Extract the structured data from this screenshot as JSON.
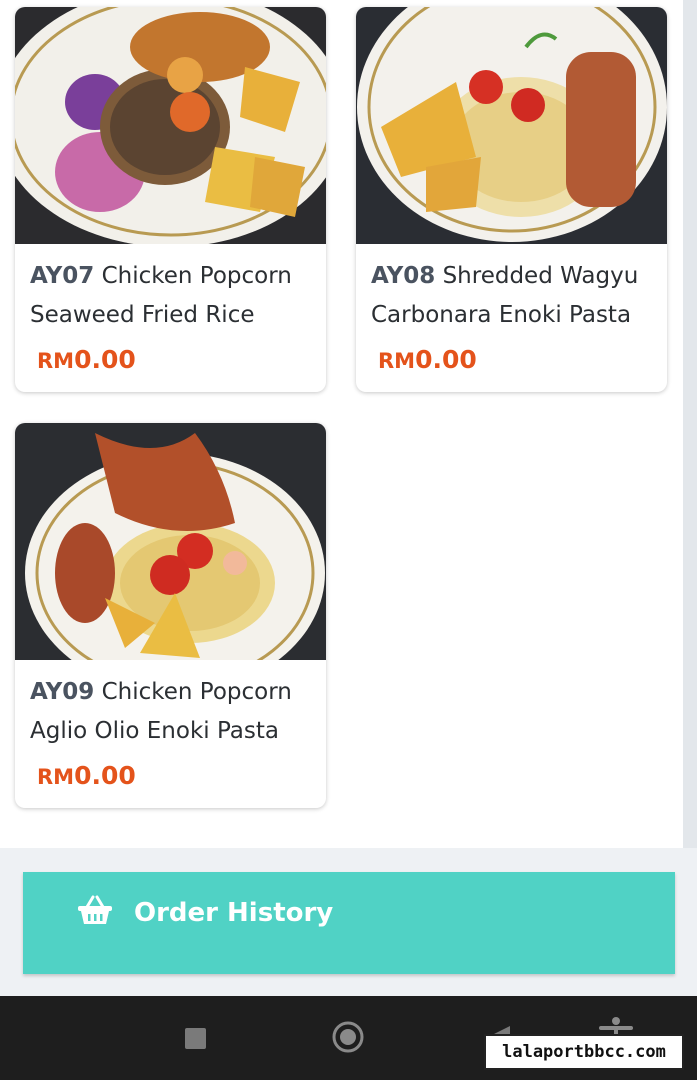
{
  "menu": {
    "items": [
      {
        "code": "AY07",
        "name": "Chicken Popcorn Seaweed Fried Rice",
        "currency": "RM",
        "price": "0.00"
      },
      {
        "code": "AY08",
        "name": "Shredded Wagyu Carbonara Enoki Pasta",
        "currency": "RM",
        "price": "0.00"
      },
      {
        "code": "AY09",
        "name": "Chicken Popcorn Aglio Olio Enoki Pasta",
        "currency": "RM",
        "price": "0.00"
      }
    ]
  },
  "footer": {
    "order_history_label": "Order History",
    "icon": "basket-icon"
  },
  "system_nav": {
    "icons": [
      "recents-square-icon",
      "home-circle-icon",
      "back-triangle-icon",
      "accessibility-icon"
    ]
  },
  "watermark": "lalaportbbcc.com",
  "colors": {
    "accent_teal": "#50d2c5",
    "price_orange": "#e4531b",
    "code_gray": "#4a5360"
  }
}
